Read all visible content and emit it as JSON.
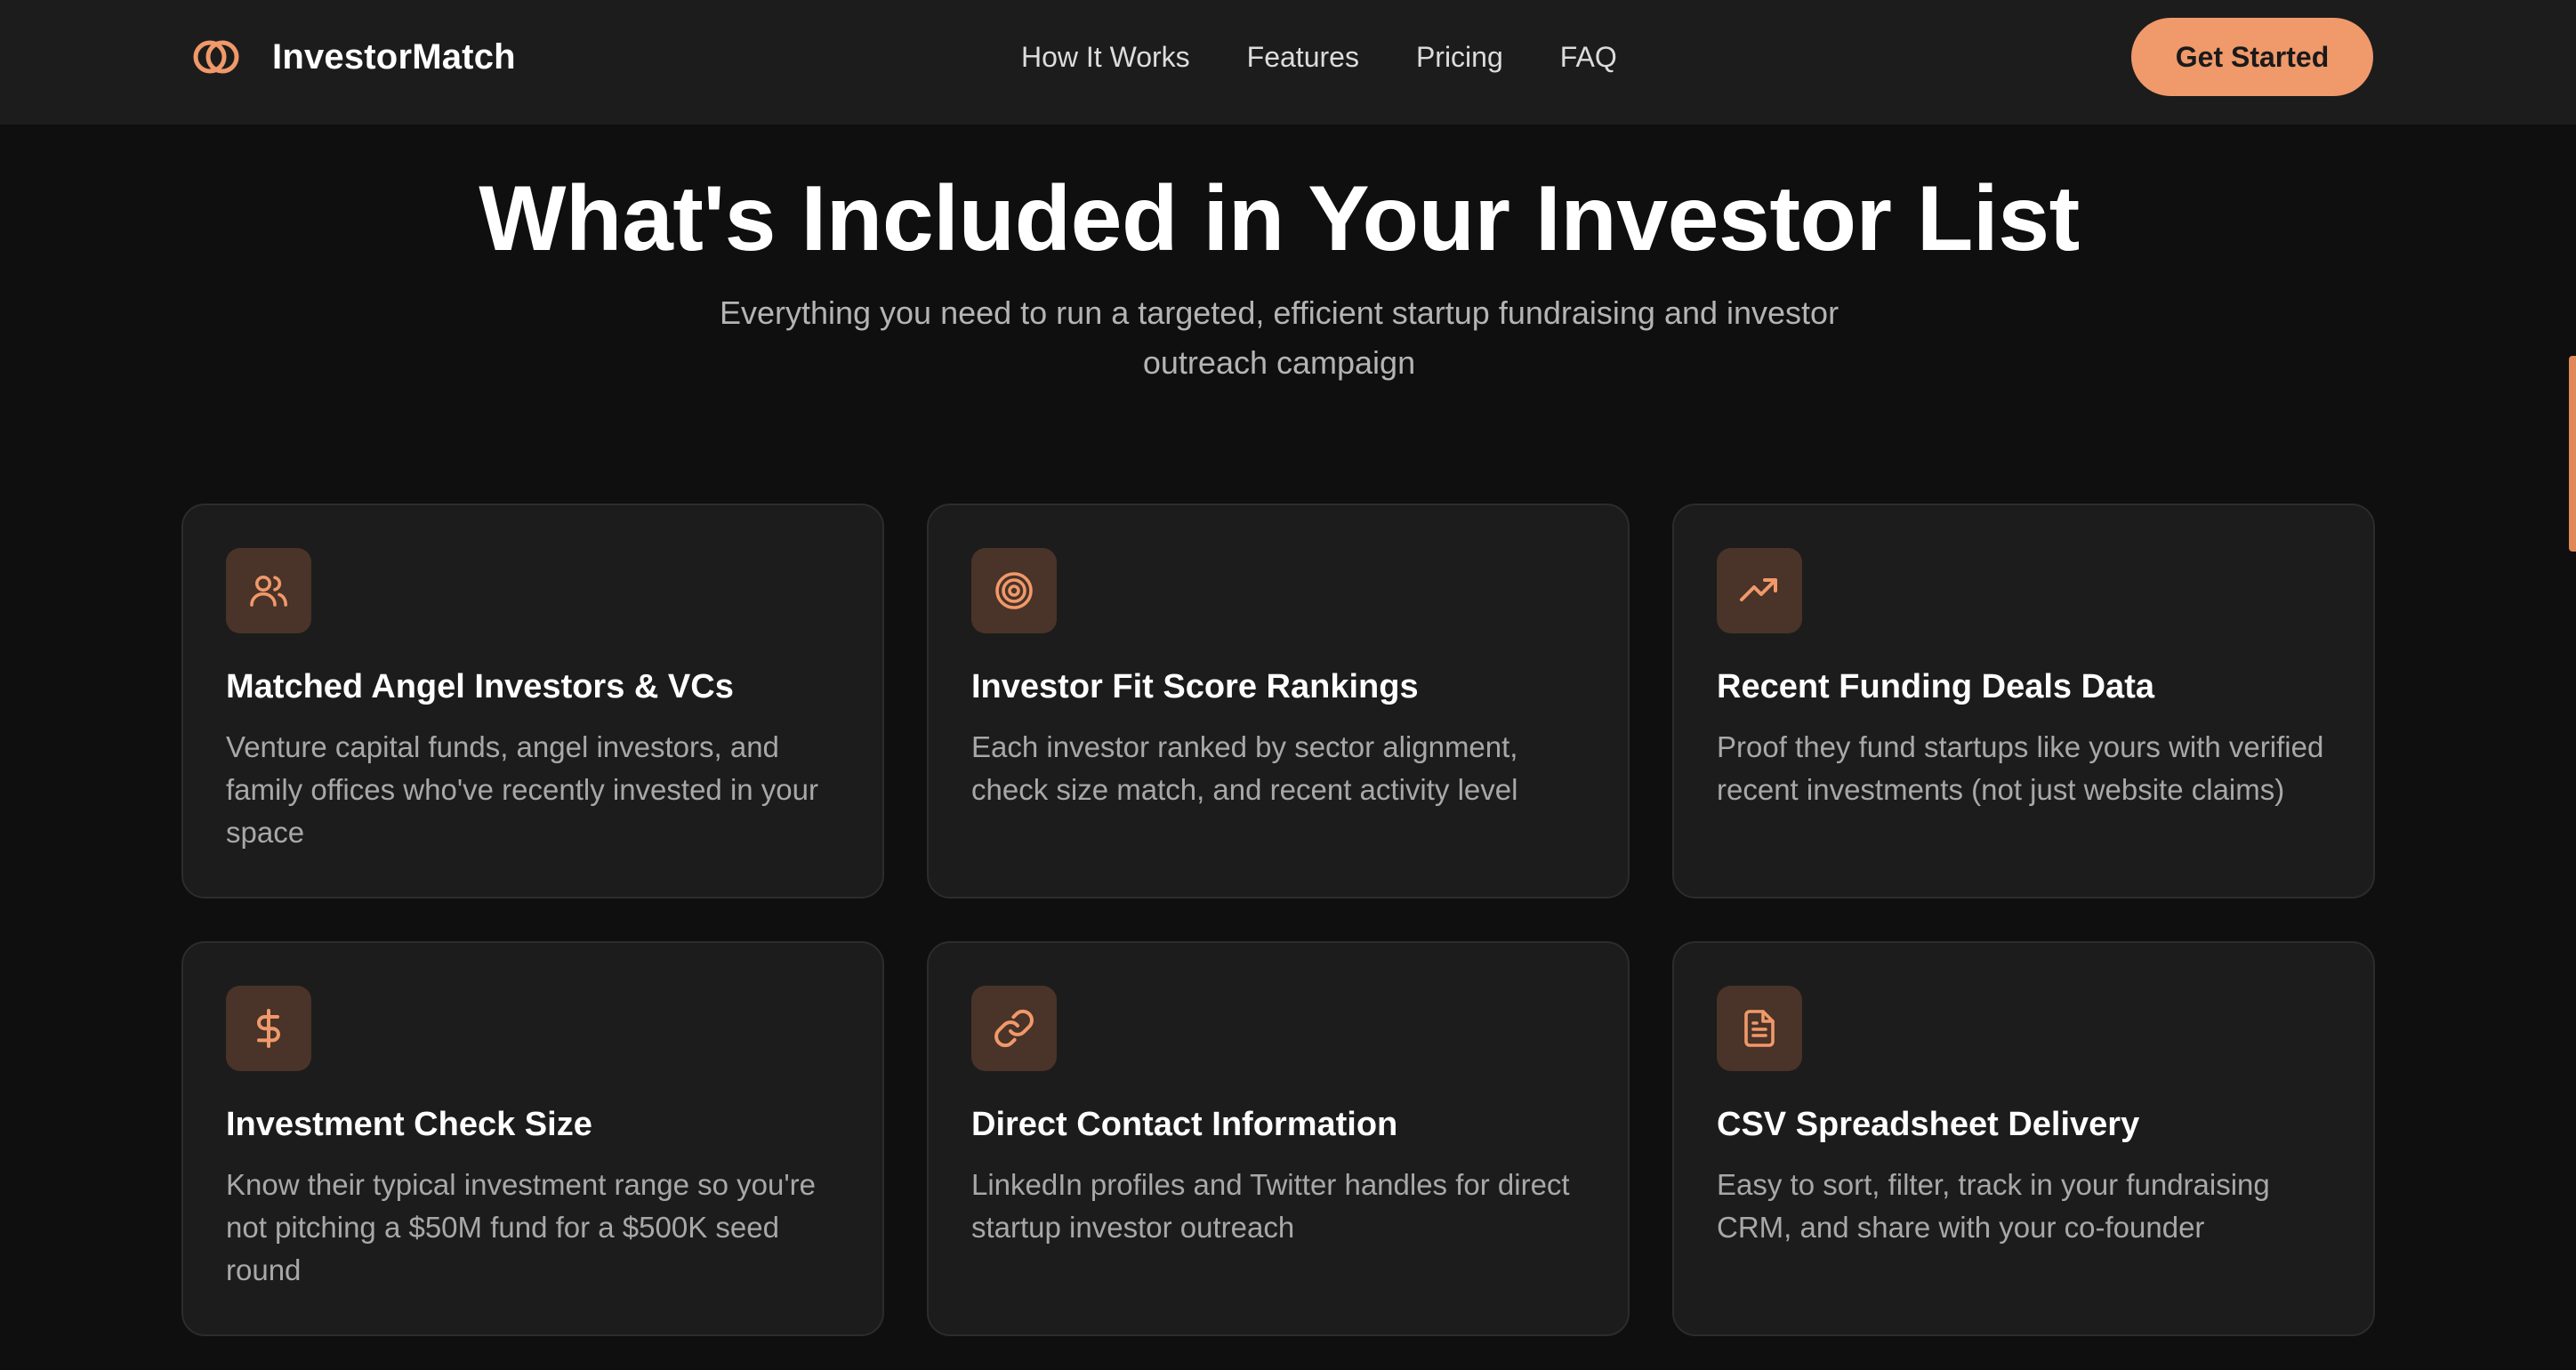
{
  "brand": {
    "name": "InvestorMatch",
    "logo_icon": "interlocking-rings-icon",
    "accent_color": "#f0996a"
  },
  "nav": {
    "links": [
      "How It Works",
      "Features",
      "Pricing",
      "FAQ"
    ],
    "cta_label": "Get Started"
  },
  "hero": {
    "title": "What's Included in Your Investor List",
    "subtitle": "Everything you need to run a targeted, efficient startup fundraising and investor outreach campaign"
  },
  "features": [
    {
      "icon": "users-icon",
      "title": "Matched Angel Investors & VCs",
      "description": "Venture capital funds, angel investors, and family offices who've recently invested in your space"
    },
    {
      "icon": "target-icon",
      "title": "Investor Fit Score Rankings",
      "description": "Each investor ranked by sector alignment, check size match, and recent activity level"
    },
    {
      "icon": "trending-up-icon",
      "title": "Recent Funding Deals Data",
      "description": "Proof they fund startups like yours with verified recent investments (not just website claims)"
    },
    {
      "icon": "dollar-sign-icon",
      "title": "Investment Check Size",
      "description": "Know their typical investment range so you're not pitching a $50M fund for a $500K seed round"
    },
    {
      "icon": "link-icon",
      "title": "Direct Contact Information",
      "description": "LinkedIn profiles and Twitter handles for direct startup investor outreach"
    },
    {
      "icon": "document-icon",
      "title": "CSV Spreadsheet Delivery",
      "description": "Easy to sort, filter, track in your fundraising CRM, and share with your co-founder"
    }
  ]
}
